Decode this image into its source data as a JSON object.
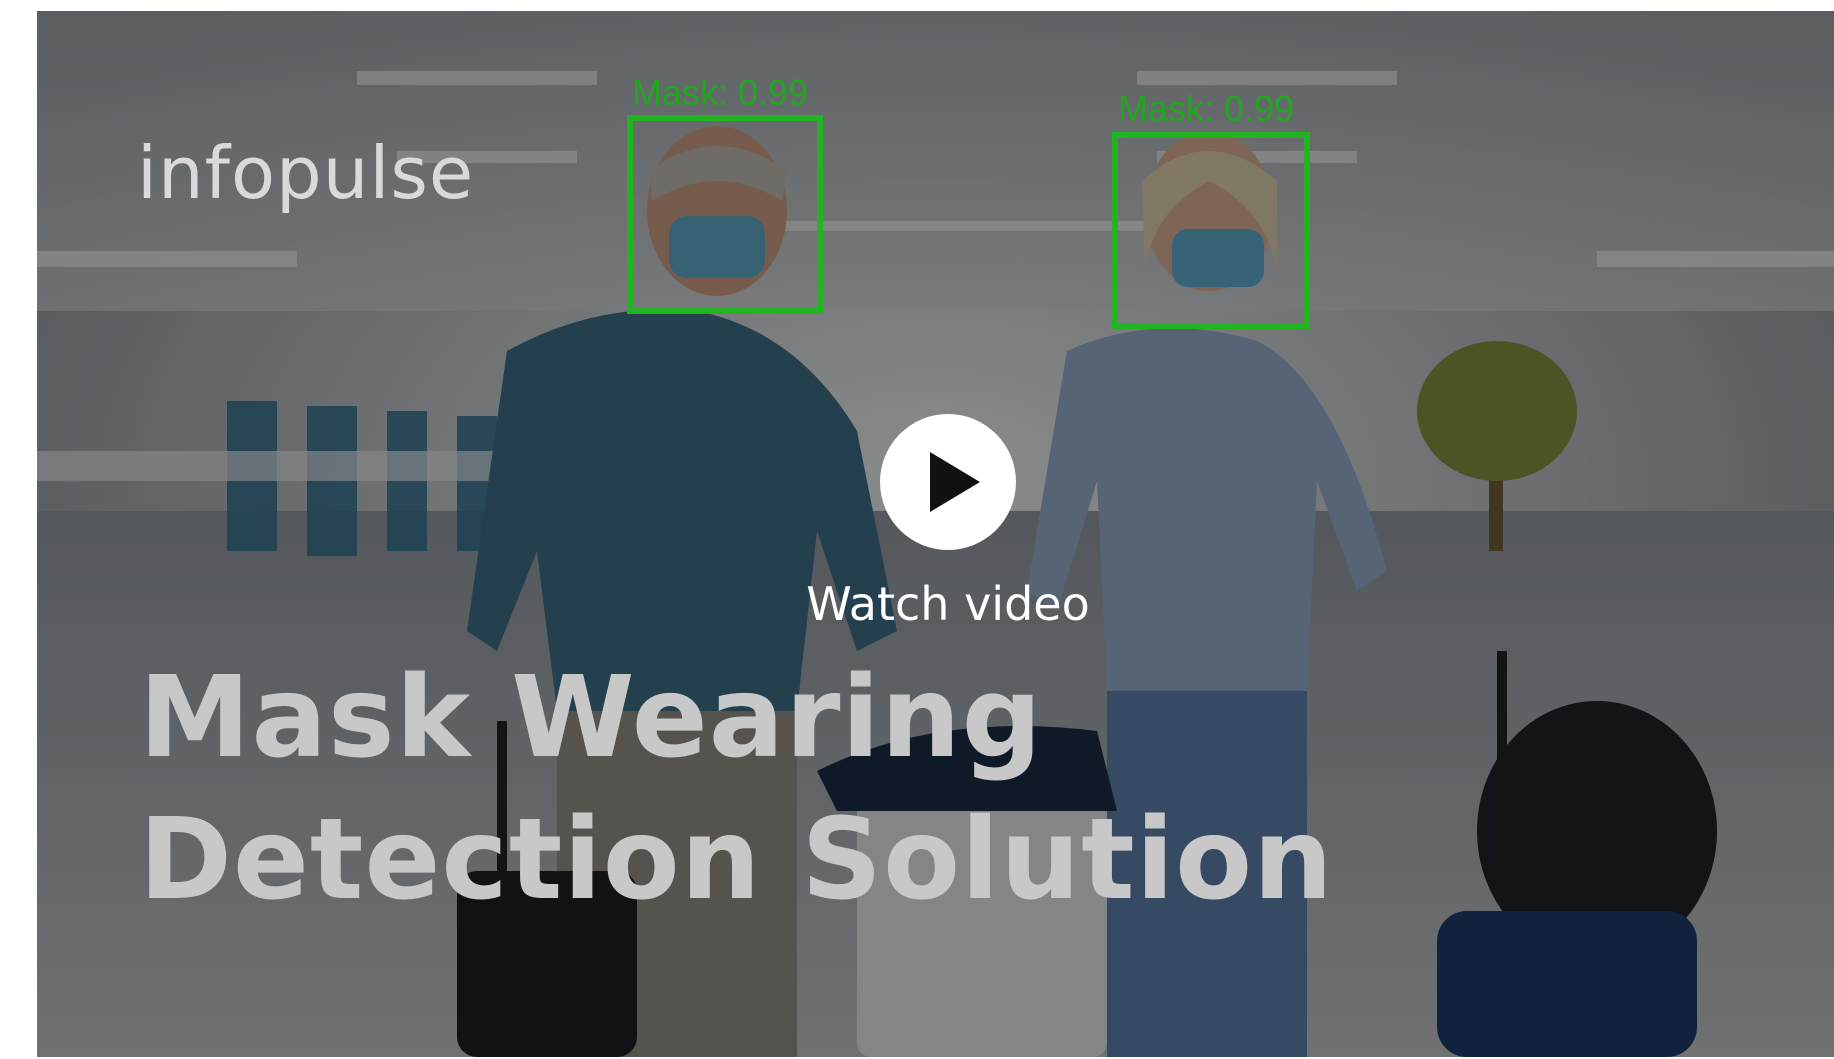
{
  "video": {
    "brand_logo": "infopulse",
    "title_line1": "Mask Wearing",
    "title_line2": "Detection Solution",
    "play_label": "Watch video"
  },
  "detections": [
    {
      "label": "Mask: 0.99"
    },
    {
      "label": "Mask: 0.99"
    }
  ],
  "colors": {
    "detection_box": "#22b322",
    "overlay_text": "#ffffff",
    "headline_text": "#c8c8c8"
  },
  "icons": {
    "play": "play-icon"
  }
}
